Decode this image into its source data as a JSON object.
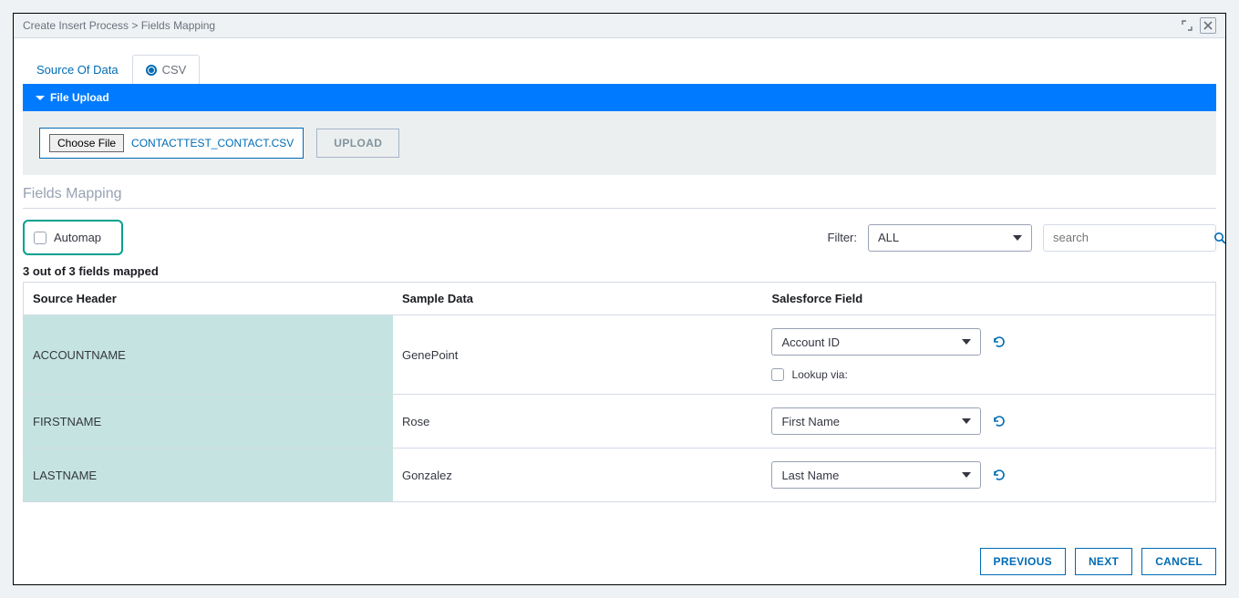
{
  "breadcrumb": "Create Insert Process > Fields Mapping",
  "tabs": {
    "source_of_data": "Source Of Data",
    "csv": "CSV"
  },
  "accordion_title": "File Upload",
  "file_upload": {
    "choose_file": "Choose File",
    "file_name": "CONTACTTEST_CONTACT.CSV",
    "upload": "UPLOAD"
  },
  "section_heading": "Fields Mapping",
  "toolbar": {
    "automap_label": "Automap",
    "filter_label": "Filter:",
    "filter_value": "ALL",
    "search_placeholder": "search"
  },
  "map_count": "3 out of 3 fields mapped",
  "columns": {
    "source_header": "Source Header",
    "sample_data": "Sample Data",
    "salesforce_field": "Salesforce Field"
  },
  "rows": [
    {
      "source": "ACCOUNTNAME",
      "sample": "GenePoint",
      "sf": "Account ID",
      "has_lookup": true,
      "lookup_label": "Lookup via:"
    },
    {
      "source": "FIRSTNAME",
      "sample": "Rose",
      "sf": "First Name",
      "has_lookup": false
    },
    {
      "source": "LASTNAME",
      "sample": "Gonzalez",
      "sf": "Last Name",
      "has_lookup": false
    }
  ],
  "footer": {
    "previous": "PREVIOUS",
    "next": "NEXT",
    "cancel": "CANCEL"
  }
}
